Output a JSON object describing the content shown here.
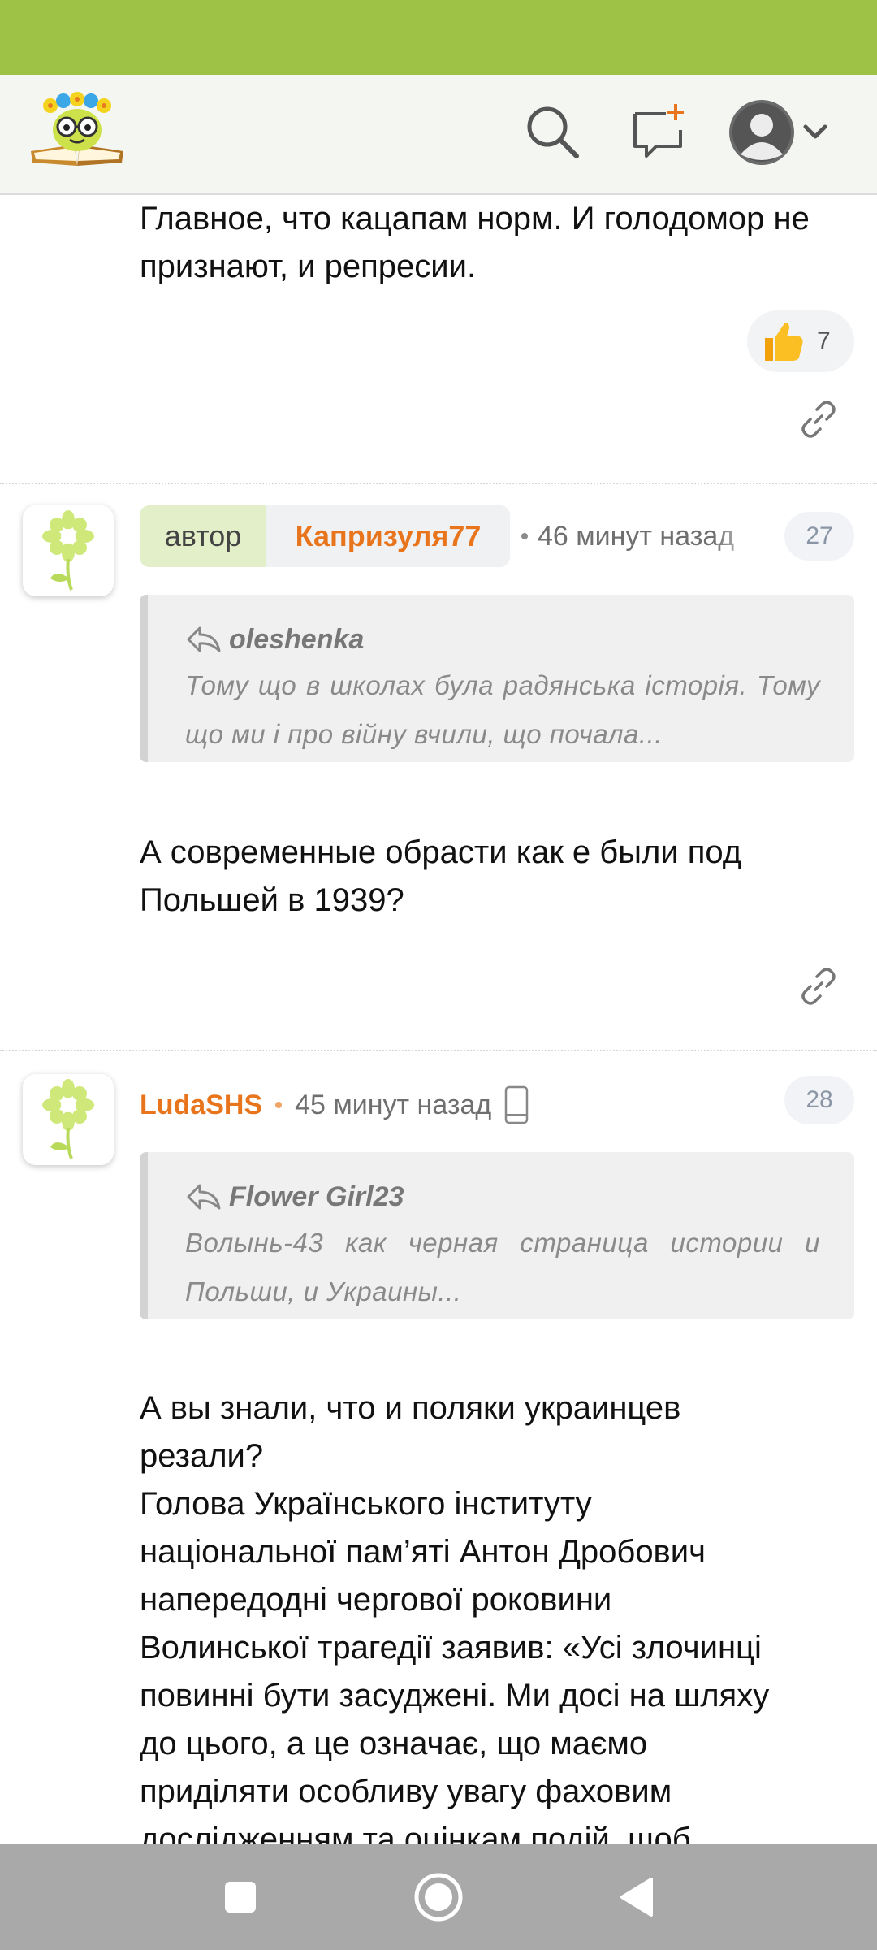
{
  "header": {
    "icons": [
      "logo",
      "search-icon",
      "new-message-icon",
      "avatar-icon",
      "chevron-down-icon"
    ]
  },
  "comments": [
    {
      "body": "Главное, что кацапам норм. И голодомор не признают, и репресии.",
      "likes": "7"
    },
    {
      "author_badge": "автор",
      "username": "Капризуля77",
      "time": "46 минут назад",
      "number": "27",
      "quote_author": "oleshenka",
      "quote_text": "Тому що в школах була радянська історія. Тому що ми і про війну вчили, що почала...",
      "body": "А современные обрасти как е были под Польшей в 1939?"
    },
    {
      "username": "LudaSHS",
      "time": "45 минут назад",
      "number": "28",
      "device_icon": "mobile-icon",
      "quote_author": "Flower Girl23",
      "quote_text": "Волынь-43 как черная страница истории и Польши, и Украины...",
      "body_lines": [
        "А вы знали, что и поляки украинцев",
        "резали?",
        "Голова Українського інституту",
        "національної пам’яті Антон Дробович",
        "напередодні чергової роковини",
        "Волинської трагедії заявив: «Усі злочинці",
        "повинні бути засуджені. Ми досі на шляху",
        "до цього, а це означає, що маємо",
        "приділяти особливу увагу фаховим",
        "дослідженням та оцінкам подій, щоб"
      ]
    }
  ],
  "colors": {
    "status_bar": "#9dc245",
    "username": "#e8741c",
    "author_badge_bg": "#e3efc9",
    "nav_bar": "#a9a9a9"
  }
}
